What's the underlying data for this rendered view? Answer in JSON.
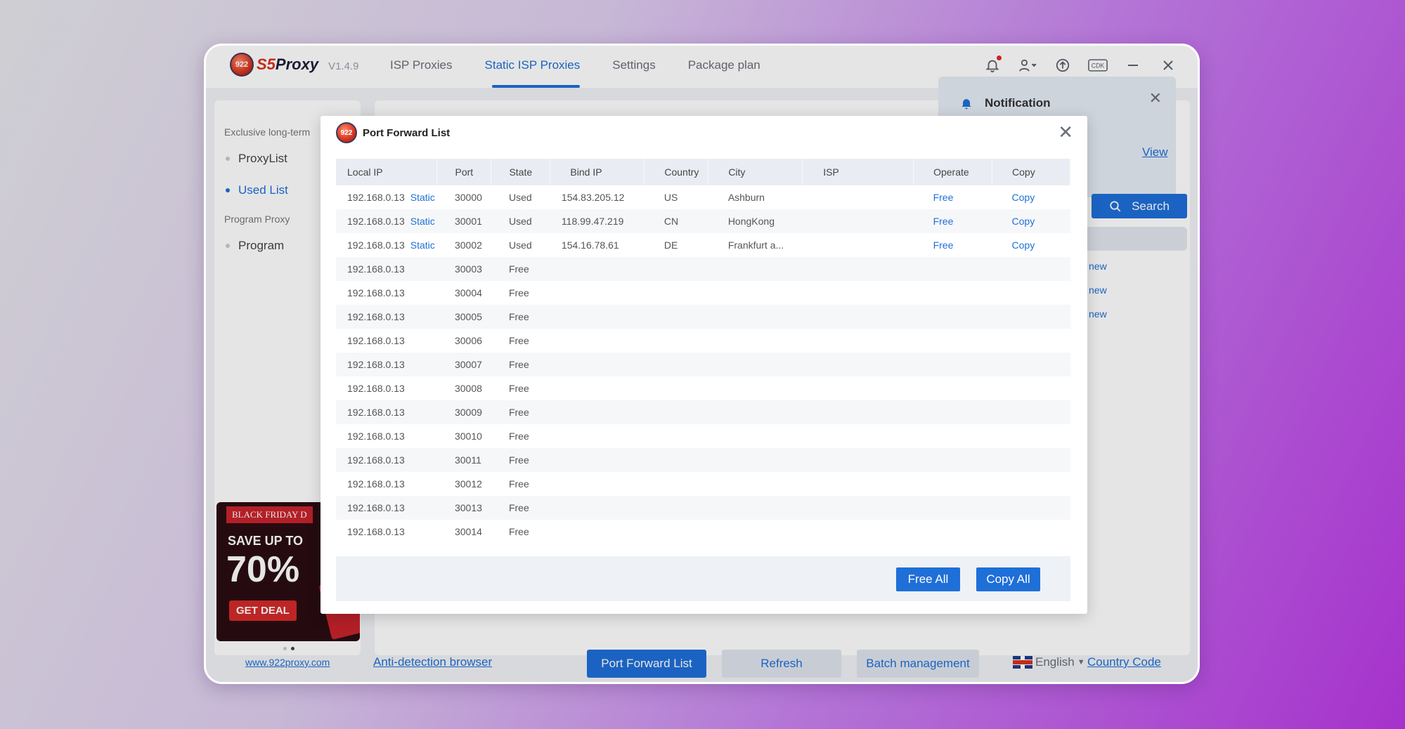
{
  "app": {
    "name_prefix": "922",
    "name_s5": "S5",
    "name_proxy": "Proxy",
    "version": "V1.4.9",
    "tabs": [
      {
        "label": "ISP Proxies"
      },
      {
        "label": "Static ISP Proxies"
      },
      {
        "label": "Settings"
      },
      {
        "label": "Package plan"
      }
    ],
    "active_tab": "Static ISP Proxies",
    "toolbar": {
      "cdk_label": "CDK"
    }
  },
  "sidebar": {
    "group1": "Exclusive long-term",
    "items1": [
      {
        "label": "ProxyList"
      },
      {
        "label": "Used List"
      }
    ],
    "group2": "Program Proxy",
    "items2": [
      {
        "label": "Program"
      }
    ]
  },
  "promo": {
    "ribbon": "BLACK FRIDAY D",
    "save": "SAVE UP TO",
    "percent": "70%",
    "deal": "GET DEAL",
    "site": "www.922proxy.com"
  },
  "background": {
    "notification_title": "Notification",
    "notification_view": "View",
    "search_label": "Search",
    "new_label": "new"
  },
  "bottombar": {
    "anti_detection": "Anti-detection browser",
    "port_forward": "Port Forward List",
    "refresh": "Refresh",
    "batch": "Batch management",
    "language": "English",
    "country_code": "Country Code"
  },
  "modal": {
    "logo": "922",
    "title": "Port Forward List",
    "columns": [
      "Local IP",
      "Port",
      "State",
      "Bind IP",
      "Country",
      "City",
      "ISP",
      "Operate",
      "Copy"
    ],
    "rows": [
      {
        "local_ip": "192.168.0.13",
        "tag": "Static",
        "port": "30000",
        "state": "Used",
        "bind_ip": "154.83.205.12",
        "country": "US",
        "city": "Ashburn",
        "isp": "",
        "operate": "Free",
        "copy": "Copy"
      },
      {
        "local_ip": "192.168.0.13",
        "tag": "Static",
        "port": "30001",
        "state": "Used",
        "bind_ip": "118.99.47.219",
        "country": "CN",
        "city": "HongKong",
        "isp": "",
        "operate": "Free",
        "copy": "Copy"
      },
      {
        "local_ip": "192.168.0.13",
        "tag": "Static",
        "port": "30002",
        "state": "Used",
        "bind_ip": "154.16.78.61",
        "country": "DE",
        "city": "Frankfurt a...",
        "isp": "",
        "operate": "Free",
        "copy": "Copy"
      },
      {
        "local_ip": "192.168.0.13",
        "tag": "",
        "port": "30003",
        "state": "Free",
        "bind_ip": "",
        "country": "",
        "city": "",
        "isp": "",
        "operate": "",
        "copy": ""
      },
      {
        "local_ip": "192.168.0.13",
        "tag": "",
        "port": "30004",
        "state": "Free",
        "bind_ip": "",
        "country": "",
        "city": "",
        "isp": "",
        "operate": "",
        "copy": ""
      },
      {
        "local_ip": "192.168.0.13",
        "tag": "",
        "port": "30005",
        "state": "Free",
        "bind_ip": "",
        "country": "",
        "city": "",
        "isp": "",
        "operate": "",
        "copy": ""
      },
      {
        "local_ip": "192.168.0.13",
        "tag": "",
        "port": "30006",
        "state": "Free",
        "bind_ip": "",
        "country": "",
        "city": "",
        "isp": "",
        "operate": "",
        "copy": ""
      },
      {
        "local_ip": "192.168.0.13",
        "tag": "",
        "port": "30007",
        "state": "Free",
        "bind_ip": "",
        "country": "",
        "city": "",
        "isp": "",
        "operate": "",
        "copy": ""
      },
      {
        "local_ip": "192.168.0.13",
        "tag": "",
        "port": "30008",
        "state": "Free",
        "bind_ip": "",
        "country": "",
        "city": "",
        "isp": "",
        "operate": "",
        "copy": ""
      },
      {
        "local_ip": "192.168.0.13",
        "tag": "",
        "port": "30009",
        "state": "Free",
        "bind_ip": "",
        "country": "",
        "city": "",
        "isp": "",
        "operate": "",
        "copy": ""
      },
      {
        "local_ip": "192.168.0.13",
        "tag": "",
        "port": "30010",
        "state": "Free",
        "bind_ip": "",
        "country": "",
        "city": "",
        "isp": "",
        "operate": "",
        "copy": ""
      },
      {
        "local_ip": "192.168.0.13",
        "tag": "",
        "port": "30011",
        "state": "Free",
        "bind_ip": "",
        "country": "",
        "city": "",
        "isp": "",
        "operate": "",
        "copy": ""
      },
      {
        "local_ip": "192.168.0.13",
        "tag": "",
        "port": "30012",
        "state": "Free",
        "bind_ip": "",
        "country": "",
        "city": "",
        "isp": "",
        "operate": "",
        "copy": ""
      },
      {
        "local_ip": "192.168.0.13",
        "tag": "",
        "port": "30013",
        "state": "Free",
        "bind_ip": "",
        "country": "",
        "city": "",
        "isp": "",
        "operate": "",
        "copy": ""
      },
      {
        "local_ip": "192.168.0.13",
        "tag": "",
        "port": "30014",
        "state": "Free",
        "bind_ip": "",
        "country": "",
        "city": "",
        "isp": "",
        "operate": "",
        "copy": ""
      }
    ],
    "free_all": "Free All",
    "copy_all": "Copy All"
  },
  "colors": {
    "accent": "#1f6fd8",
    "brand_red": "#d8321c",
    "notification_dot": "#e5242b"
  }
}
